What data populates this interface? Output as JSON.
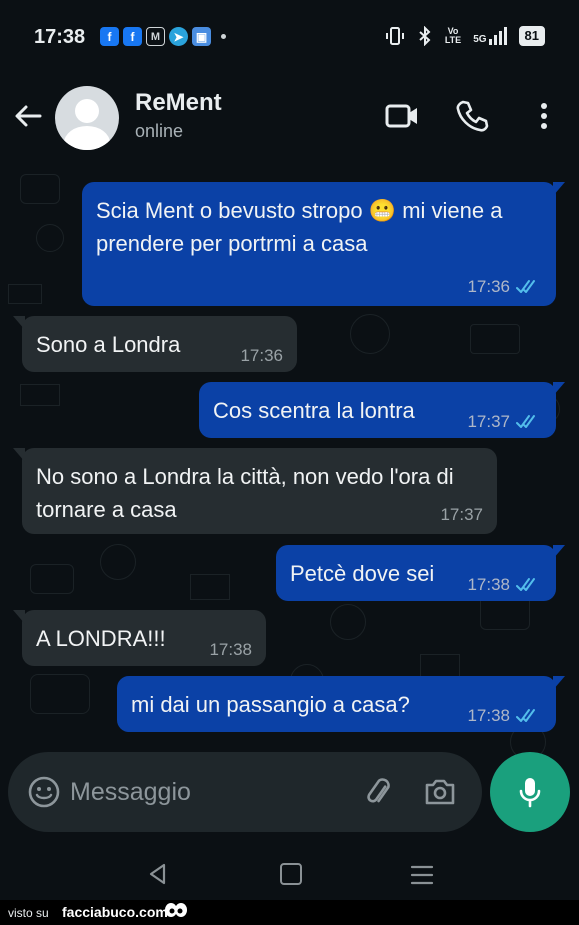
{
  "status_bar": {
    "time": "17:38",
    "app_icons": [
      "facebook-icon",
      "facebook-icon",
      "gmail-icon",
      "telegram-icon",
      "photos-icon"
    ],
    "network": "5G",
    "volte_top": "Vo",
    "volte_bottom": "LTE",
    "battery": "81"
  },
  "header": {
    "contact_name": "ReMent",
    "contact_status": "online"
  },
  "messages": [
    {
      "direction": "out",
      "text": "Scia Ment o bevusto stropo 😬 mi viene a prendere per portrmi a casa",
      "time": "17:36",
      "read": true
    },
    {
      "direction": "in",
      "text": "Sono a Londra",
      "time": "17:36"
    },
    {
      "direction": "out",
      "text": "Cos scentra la lontra",
      "time": "17:37",
      "read": true
    },
    {
      "direction": "in",
      "text": "No sono a Londra la città, non vedo l'ora di tornare a casa",
      "time": "17:37"
    },
    {
      "direction": "out",
      "text": "Petcè dove sei",
      "time": "17:38",
      "read": true
    },
    {
      "direction": "in",
      "text": "A LONDRA!!!",
      "time": "17:38"
    },
    {
      "direction": "out",
      "text": "mi dai un passangio a casa?",
      "time": "17:38",
      "read": true
    }
  ],
  "composer": {
    "placeholder": "Messaggio"
  },
  "footer": {
    "visto": "visto su",
    "site": "facciabuco.com"
  },
  "colors": {
    "outgoing_bubble": "#0b41a6",
    "incoming_bubble": "#262d31",
    "read_ticks": "#53bdeb",
    "mic_button": "#1aa07d"
  }
}
